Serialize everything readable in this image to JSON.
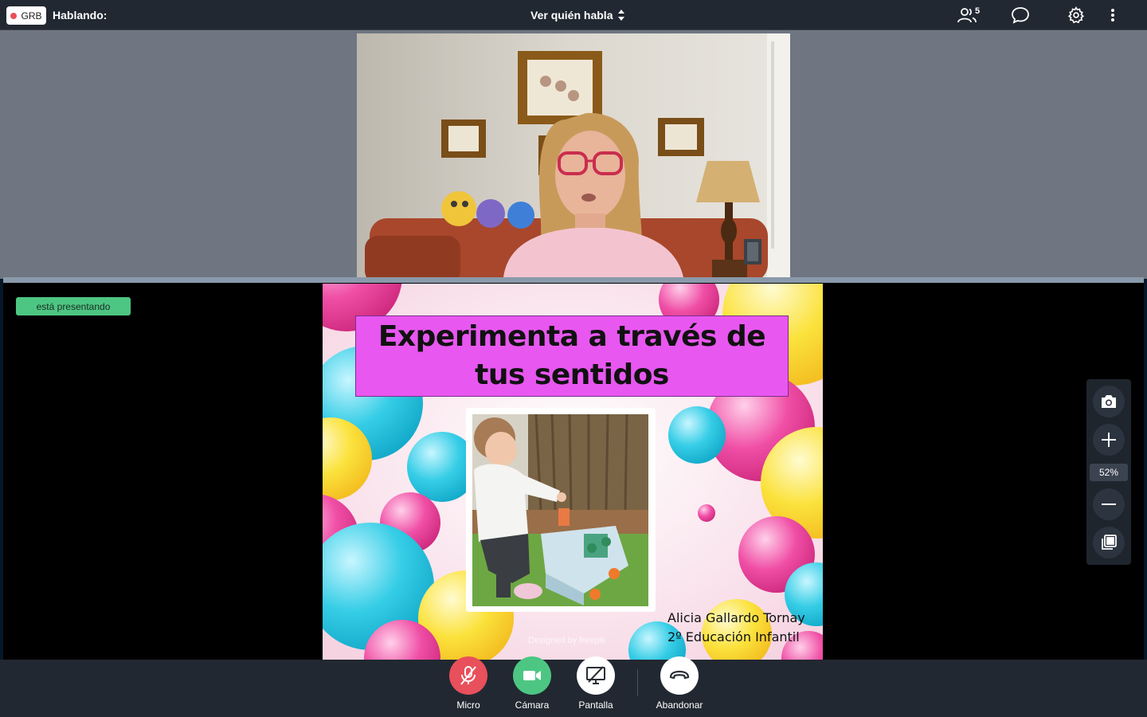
{
  "topbar": {
    "recording_badge": "GRB",
    "talking_label": "Hablando:",
    "layout_label": "Ver quién habla",
    "participants_count": "5"
  },
  "presentation": {
    "presenting_label": "está presentando",
    "slide": {
      "title_line1": "Experimenta a través de",
      "title_line2": "tus sentidos",
      "author_name": "Alicia Gallardo Tornay",
      "author_course": "2º Educación Infantil",
      "watermark": "Designed by  freepik"
    }
  },
  "zoom": {
    "level": "52%"
  },
  "controls": {
    "mic_label": "Micro",
    "camera_label": "Cámara",
    "screen_label": "Pantalla",
    "leave_label": "Abandonar"
  },
  "colors": {
    "mic_muted": "#e8505b",
    "camera_on": "#4dc683",
    "presenting": "#4dc683",
    "title_box": "#e857f0"
  }
}
